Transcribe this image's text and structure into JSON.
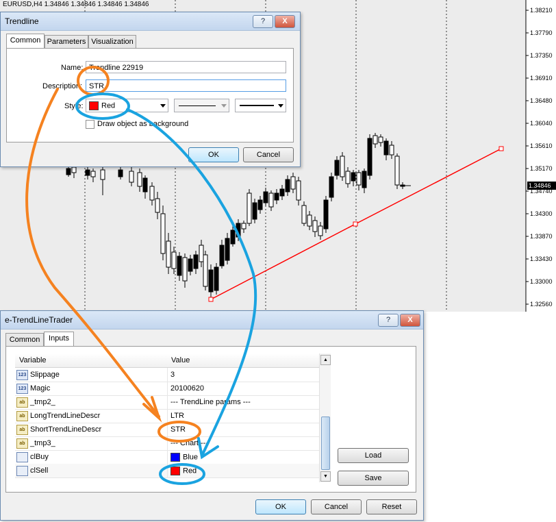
{
  "chart": {
    "header": "EURUSD,H4  1.34846 1.34846 1.34846 1.34846",
    "current_price": "1.34846",
    "price_labels": [
      "1.38210",
      "1.37790",
      "1.37350",
      "1.36910",
      "1.36480",
      "1.36040",
      "1.35610",
      "1.35170",
      "1.34740",
      "1.34300",
      "1.33870",
      "1.33430",
      "1.33000",
      "1.32560"
    ],
    "trendline_color": "#ff0000"
  },
  "trendline_dialog": {
    "title": "Trendline",
    "help_label": "?",
    "close_label": "X",
    "tabs": [
      "Common",
      "Parameters",
      "Visualization"
    ],
    "name_label": "Name:",
    "name_value": "Trendline 22919",
    "description_label": "Description:",
    "description_value": "STR",
    "style_label": "Style:",
    "color_value": "Red",
    "color_swatch": "#ff0000",
    "checkbox_label": "Draw object as background",
    "ok_label": "OK",
    "cancel_label": "Cancel"
  },
  "ea_dialog": {
    "title": "e-TrendLineTrader",
    "help_label": "?",
    "close_label": "X",
    "tabs": [
      "Common",
      "Inputs"
    ],
    "columns": [
      "Variable",
      "Value"
    ],
    "rows": [
      {
        "icon": "123",
        "name": "Slippage",
        "value": "3"
      },
      {
        "icon": "123",
        "name": "Magic",
        "value": "20100620"
      },
      {
        "icon": "ab",
        "name": "_tmp2_",
        "value": "--- TrendLine params ---"
      },
      {
        "icon": "ab",
        "name": "LongTrendLineDescr",
        "value": "LTR"
      },
      {
        "icon": "ab",
        "name": "ShortTrendLineDescr",
        "value": "STR"
      },
      {
        "icon": "ab",
        "name": "_tmp3_",
        "value": "--- Chart ---"
      },
      {
        "icon": "cl",
        "name": "clBuy",
        "value": "Blue",
        "swatch": "#0000ff"
      },
      {
        "icon": "cl",
        "name": "clSell",
        "value": "Red",
        "swatch": "#ff0000"
      }
    ],
    "load_label": "Load",
    "save_label": "Save",
    "ok_label": "OK",
    "cancel_label": "Cancel",
    "reset_label": "Reset"
  },
  "annotation_colors": {
    "orange": "#f58220",
    "blue": "#1aa3e0"
  }
}
